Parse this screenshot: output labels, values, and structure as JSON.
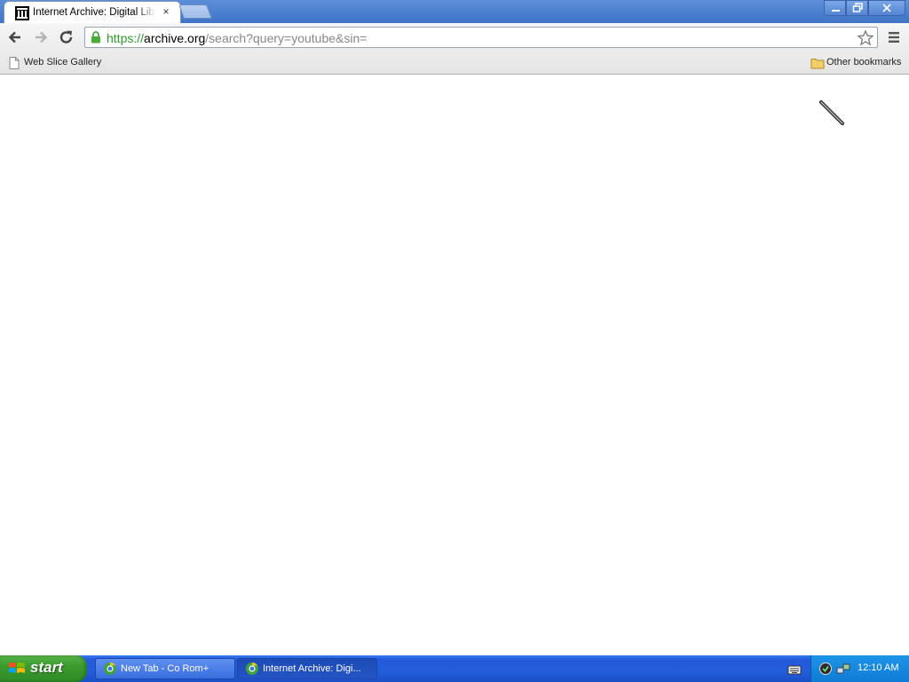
{
  "browser": {
    "tab": {
      "title": "Internet Archive: Digital Libra",
      "favicon": "internet-archive-icon",
      "close_label": "×"
    },
    "window_controls": [
      "minimize-icon",
      "restore-icon",
      "close-icon"
    ],
    "omnibox": {
      "scheme": "https://",
      "host": "archive.org",
      "path": "/search?query=youtube&sin="
    },
    "nav": [
      "back-arrow-icon",
      "forward-arrow-icon",
      "reload-icon"
    ],
    "bookmarks": {
      "web_slice_gallery": "Web Slice Gallery",
      "other_bookmarks": "Other bookmarks"
    }
  },
  "taskbar": {
    "start_label": "start",
    "tasks": [
      {
        "label": "New Tab - Co Rom+",
        "icon": "chrome-icon"
      },
      {
        "label": "Internet Archive: Digi...",
        "icon": "chrome-icon"
      }
    ],
    "clock": "12:10 AM"
  },
  "colors": {
    "title_bar": "#4a7fcf",
    "url_scheme": "#2e9a2e",
    "url_path": "#888888",
    "taskbar": "#245edb",
    "start_button": "#3c9a2f"
  }
}
